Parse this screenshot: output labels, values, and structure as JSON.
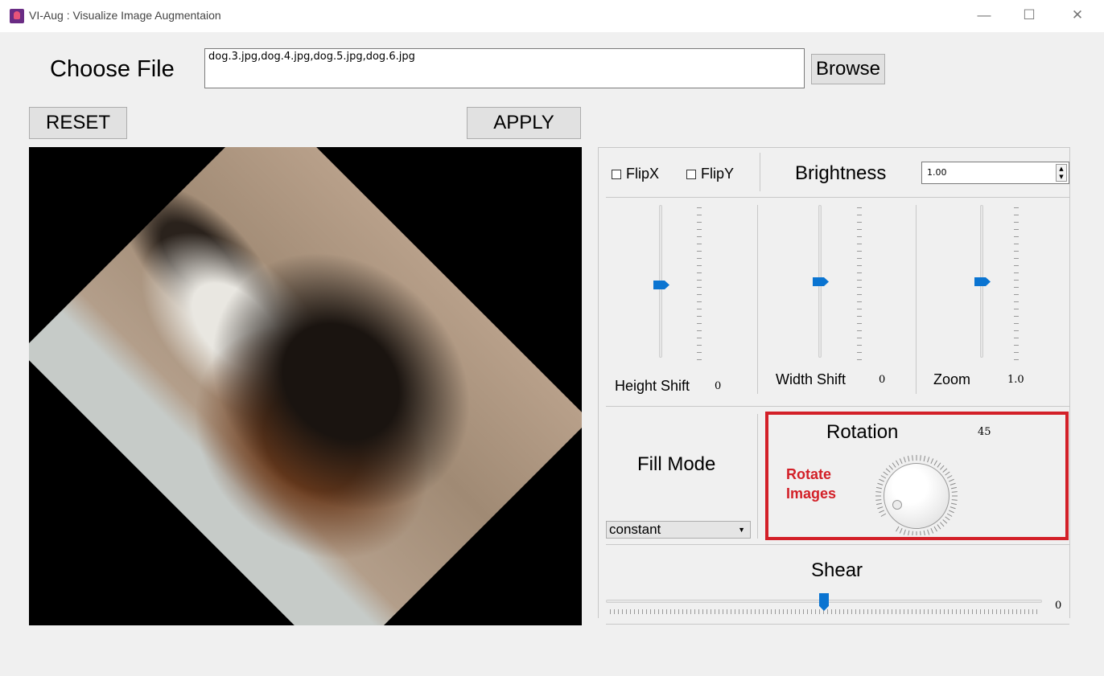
{
  "window": {
    "title": "VI-Aug : Visualize Image Augmentaion",
    "controls": {
      "minimize": "—",
      "maximize": "☐",
      "close": "✕"
    }
  },
  "file": {
    "label": "Choose File",
    "value": "dog.3.jpg,dog.4.jpg,dog.5.jpg,dog.6.jpg",
    "browse_label": "Browse"
  },
  "actions": {
    "reset_label": "RESET",
    "apply_label": "APPLY"
  },
  "preview": {
    "rotation_degrees": 45
  },
  "flip": {
    "x_label": "FlipX",
    "y_label": "FlipY",
    "x_checked": false,
    "y_checked": false
  },
  "brightness": {
    "label": "Brightness",
    "value": "1.00"
  },
  "sliders": {
    "height_shift": {
      "label": "Height Shift",
      "value": "0"
    },
    "width_shift": {
      "label": "Width Shift",
      "value": "0"
    },
    "zoom": {
      "label": "Zoom",
      "value": "1.0"
    }
  },
  "fill_mode": {
    "label": "Fill Mode",
    "selected": "constant"
  },
  "rotation": {
    "label": "Rotation",
    "value": "45",
    "caption": "Rotate Images"
  },
  "shear": {
    "label": "Shear",
    "value": "0"
  },
  "colors": {
    "accent": "#0a74d1",
    "highlight": "#d32028"
  }
}
